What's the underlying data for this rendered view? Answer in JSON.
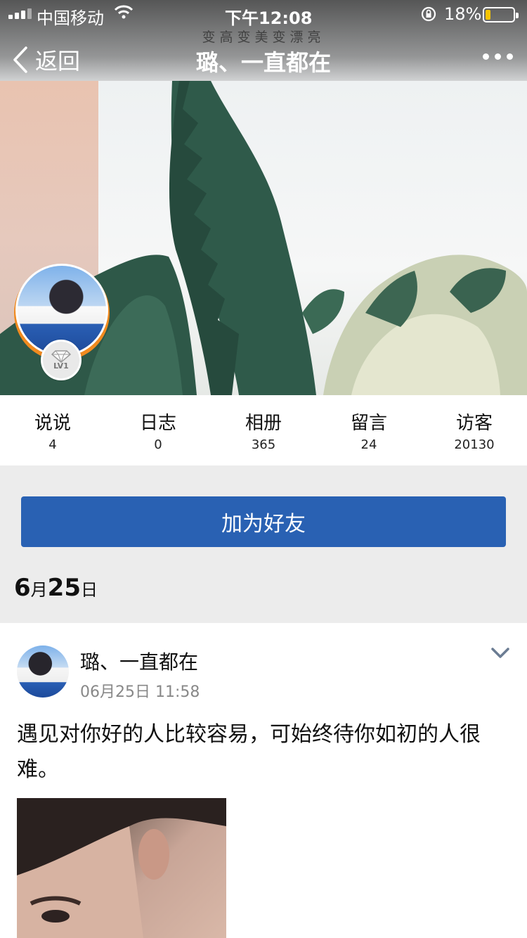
{
  "status_bar": {
    "carrier": "中国移动",
    "time": "下午12:08",
    "battery_percent": "18%",
    "battery_level": 0.18
  },
  "nav": {
    "back_label": "返回",
    "title": "璐、一直都在",
    "cover_watermark": "变高变美变漂亮"
  },
  "profile": {
    "level_badge": "LV1",
    "accent_color": "#f08a1f"
  },
  "stats": [
    {
      "label": "说说",
      "value": "4"
    },
    {
      "label": "日志",
      "value": "0"
    },
    {
      "label": "相册",
      "value": "365"
    },
    {
      "label": "留言",
      "value": "24"
    },
    {
      "label": "访客",
      "value": "20130"
    }
  ],
  "add_friend": {
    "label": "加为好友",
    "color": "#2961b3"
  },
  "date_header": {
    "month": "6",
    "month_unit": "月",
    "day": "25",
    "day_unit": "日"
  },
  "post": {
    "author": "璐、一直都在",
    "timestamp": "06月25日 11:58",
    "text": "遇见对你好的人比较容易，可始终待你如初的人很难。"
  }
}
